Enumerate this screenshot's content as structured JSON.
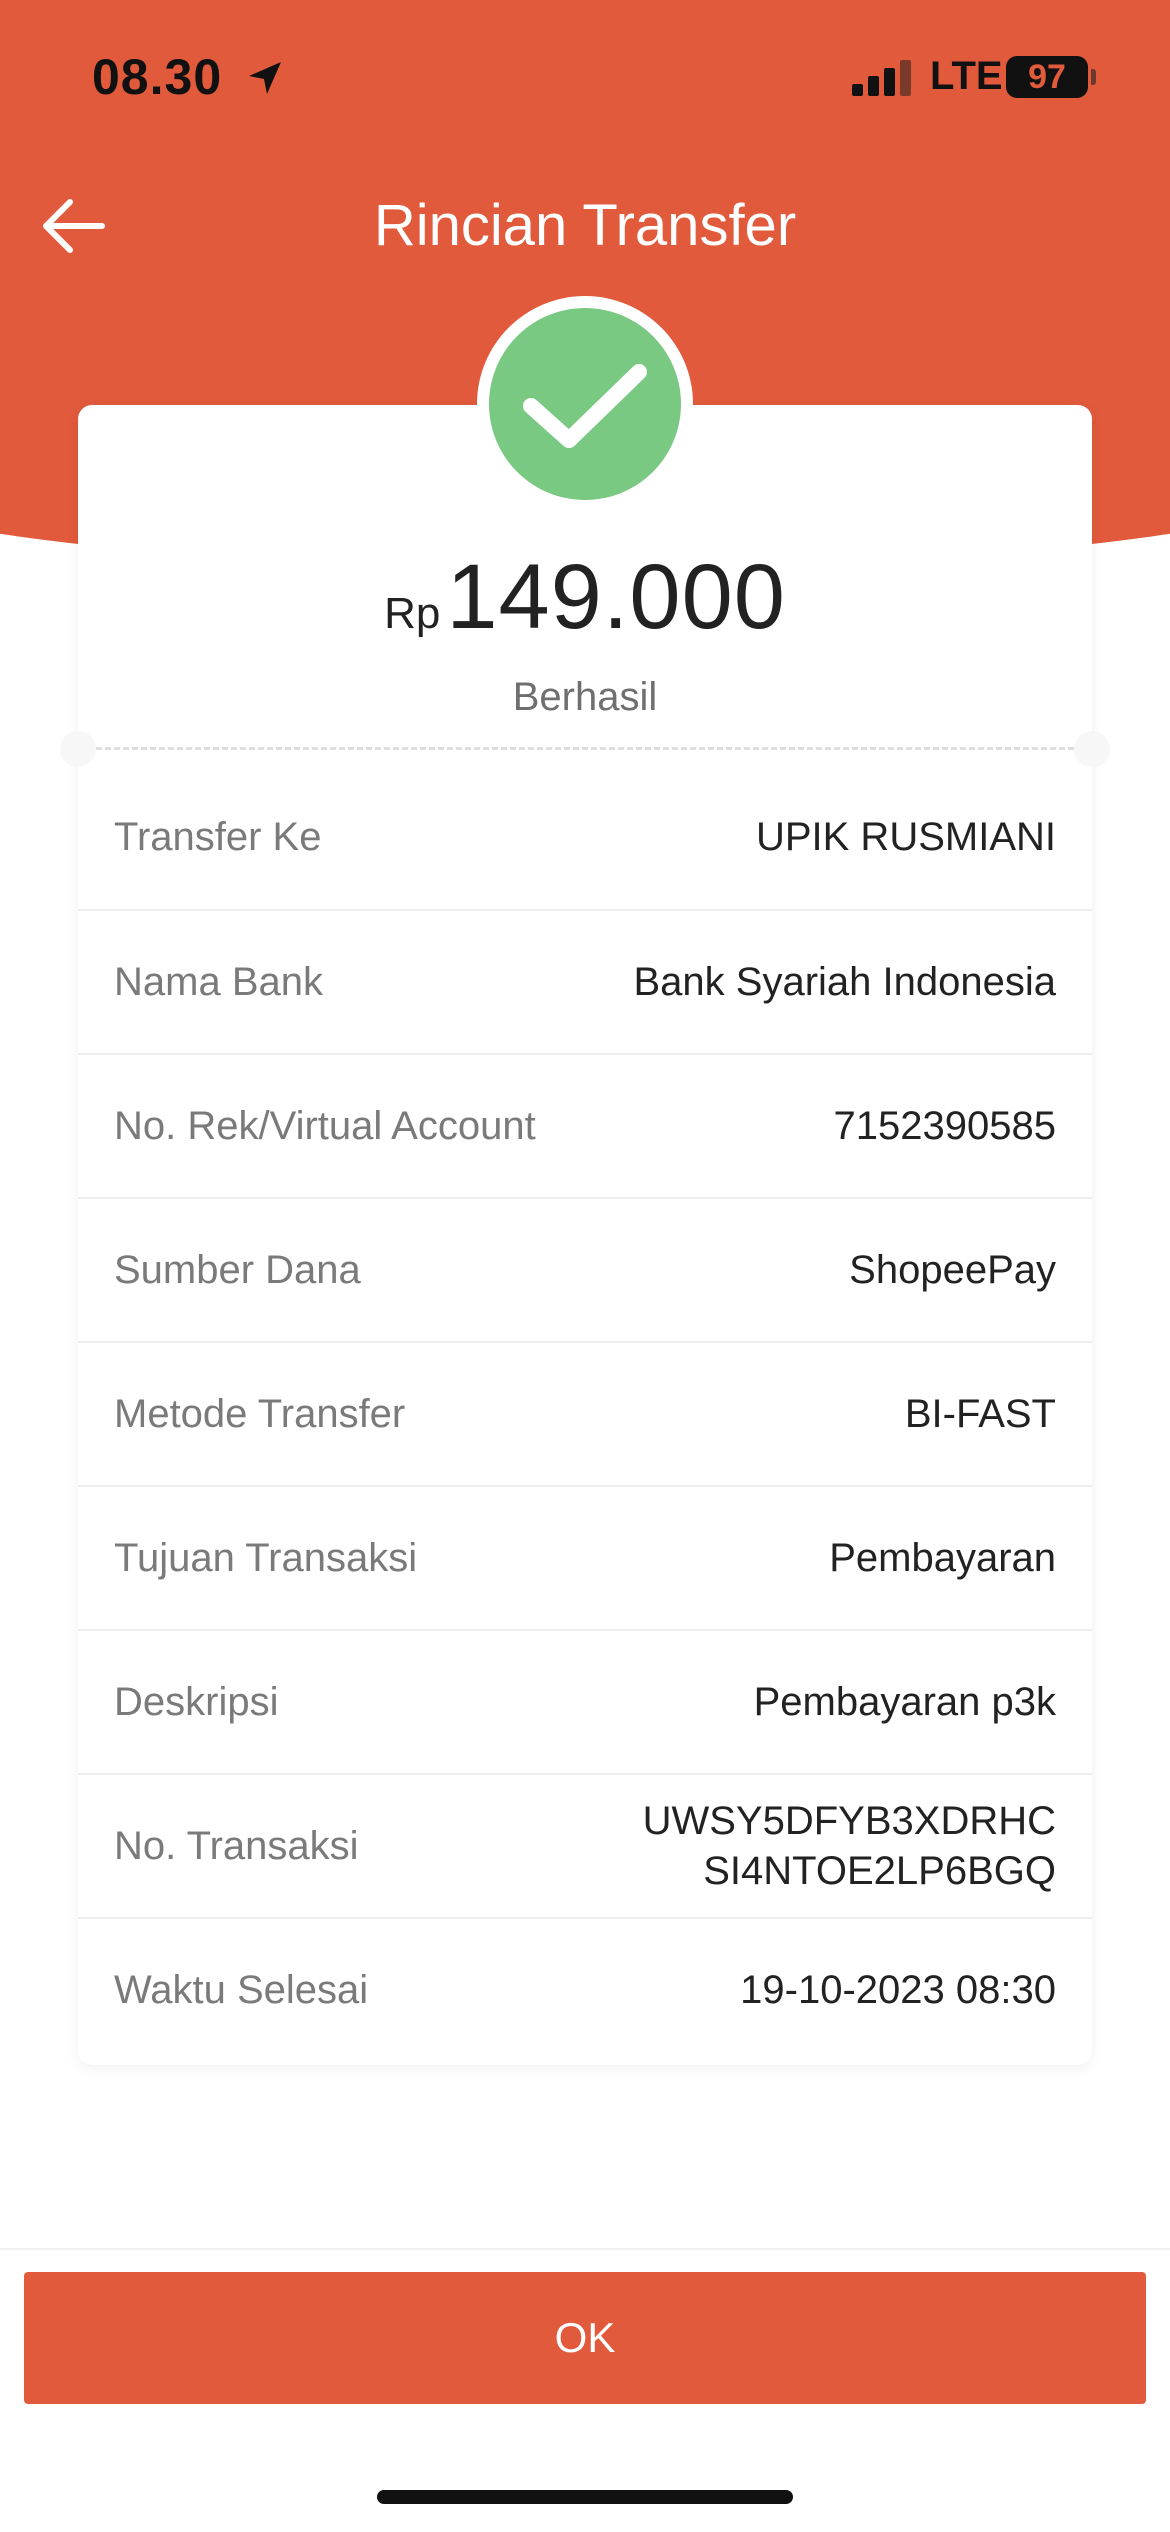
{
  "status_bar": {
    "time": "08.30",
    "network": "LTE",
    "battery": "97"
  },
  "nav": {
    "title": "Rincian Transfer"
  },
  "summary": {
    "currency": "Rp",
    "amount": "149.000",
    "status": "Berhasil"
  },
  "details": [
    {
      "label": "Transfer Ke",
      "value": "UPIK RUSMIANI"
    },
    {
      "label": "Nama Bank",
      "value": "Bank Syariah Indonesia"
    },
    {
      "label": "No. Rek/Virtual Account",
      "value": "7152390585"
    },
    {
      "label": "Sumber Dana",
      "value": "ShopeePay"
    },
    {
      "label": "Metode Transfer",
      "value": "BI-FAST"
    },
    {
      "label": "Tujuan Transaksi",
      "value": "Pembayaran"
    },
    {
      "label": "Deskripsi",
      "value": "Pembayaran p3k"
    },
    {
      "label": "No. Transaksi",
      "value": "UWSY5DFYB3XDRHC",
      "value_line2": "SI4NTOE2LP6BGQ"
    },
    {
      "label": "Waktu Selesai",
      "value": "19-10-2023 08:30"
    }
  ],
  "actions": {
    "ok_label": "OK"
  },
  "colors": {
    "brand": "#e05a3b",
    "success": "#79c983"
  },
  "icons": {
    "back": "arrow-left-icon",
    "success": "check-icon",
    "location": "location-arrow-icon"
  }
}
